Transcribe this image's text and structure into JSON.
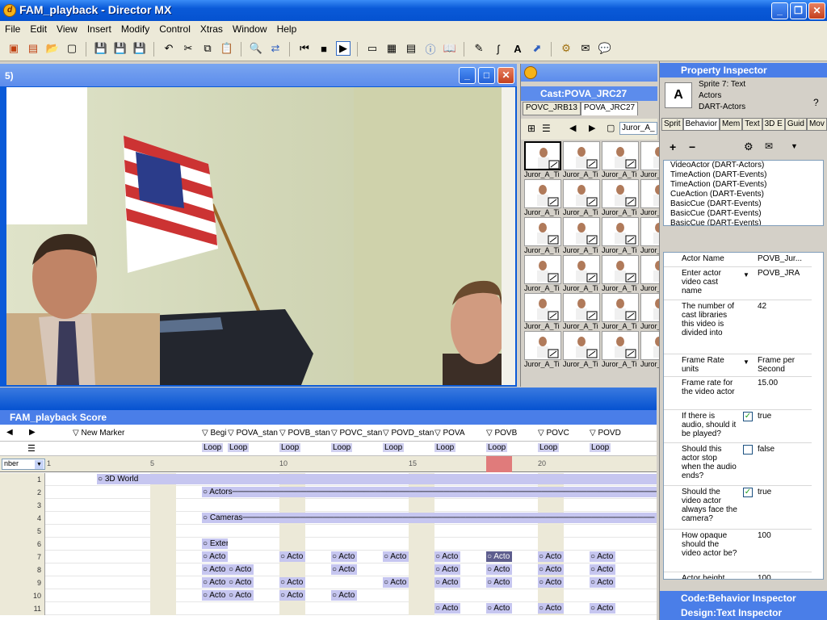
{
  "window": {
    "title": "FAM_playback - Director MX"
  },
  "menu": [
    "File",
    "Edit",
    "View",
    "Insert",
    "Modify",
    "Control",
    "Xtras",
    "Window",
    "Help"
  ],
  "stage": {
    "title_fragment": "5)"
  },
  "cast": {
    "title": "Cast:POVA_JRC27",
    "tabs": [
      "POVC_JRB13",
      "POVA_JRC27"
    ],
    "member_field": "Juror_A_",
    "member_label": "Juror_A_Ti"
  },
  "score": {
    "title": "FAM_playback Score",
    "markers": [
      "New Marker",
      "Begi",
      "POVA_stan",
      "POVB_stan",
      "POVC_stan",
      "POVD_stan",
      "POVA",
      "POVB",
      "POVC",
      "POVD"
    ],
    "loop_label": "Loop",
    "frame_ticks": [
      "1",
      "5",
      "10",
      "15",
      "20"
    ],
    "number_label": "nber",
    "channels": [
      "1",
      "2",
      "3",
      "4",
      "5",
      "6",
      "7",
      "8",
      "9",
      "10",
      "11"
    ],
    "sprites": {
      "world": "3D World",
      "actors": "Actors",
      "cameras": "Cameras",
      "exter": "Exter",
      "acto": "Acto"
    }
  },
  "property_inspector": {
    "title": "Property Inspector",
    "sprite_line": "Sprite 7: Text",
    "member_line": "Actors",
    "cast_line": "DART-Actors",
    "tabs": [
      "Sprit",
      "Behavior",
      "Mem",
      "Text",
      "3D E",
      "Guid",
      "Mov"
    ],
    "behaviors": [
      "VideoActor (DART-Actors)",
      "TimeAction (DART-Events)",
      "TimeAction (DART-Events)",
      "CueAction (DART-Events)",
      "BasicCue (DART-Events)",
      "BasicCue (DART-Events)",
      "BasicCue (DART-Events)"
    ],
    "props": [
      {
        "label": "Actor Name",
        "value": "POVB_Jur..."
      },
      {
        "label": "Enter actor video cast name",
        "value": "POVB_JRA"
      },
      {
        "label": "The number of cast libraries this video is divided into",
        "value": "42"
      },
      {
        "label": "Frame Rate units",
        "value": "Frame per Second"
      },
      {
        "label": "Frame rate for the video actor",
        "value": "15.00"
      },
      {
        "label": "If there is audio, should it be played?",
        "value": "true"
      },
      {
        "label": "Should this actor stop when the audio ends?",
        "value": "false"
      },
      {
        "label": "Should the video actor always face the camera?",
        "value": "true"
      },
      {
        "label": "How opaque should the video actor be?",
        "value": "100"
      },
      {
        "label": "Actor height",
        "value": "100"
      }
    ],
    "footer1": "Code:Behavior Inspector",
    "footer2": "Design:Text Inspector"
  }
}
